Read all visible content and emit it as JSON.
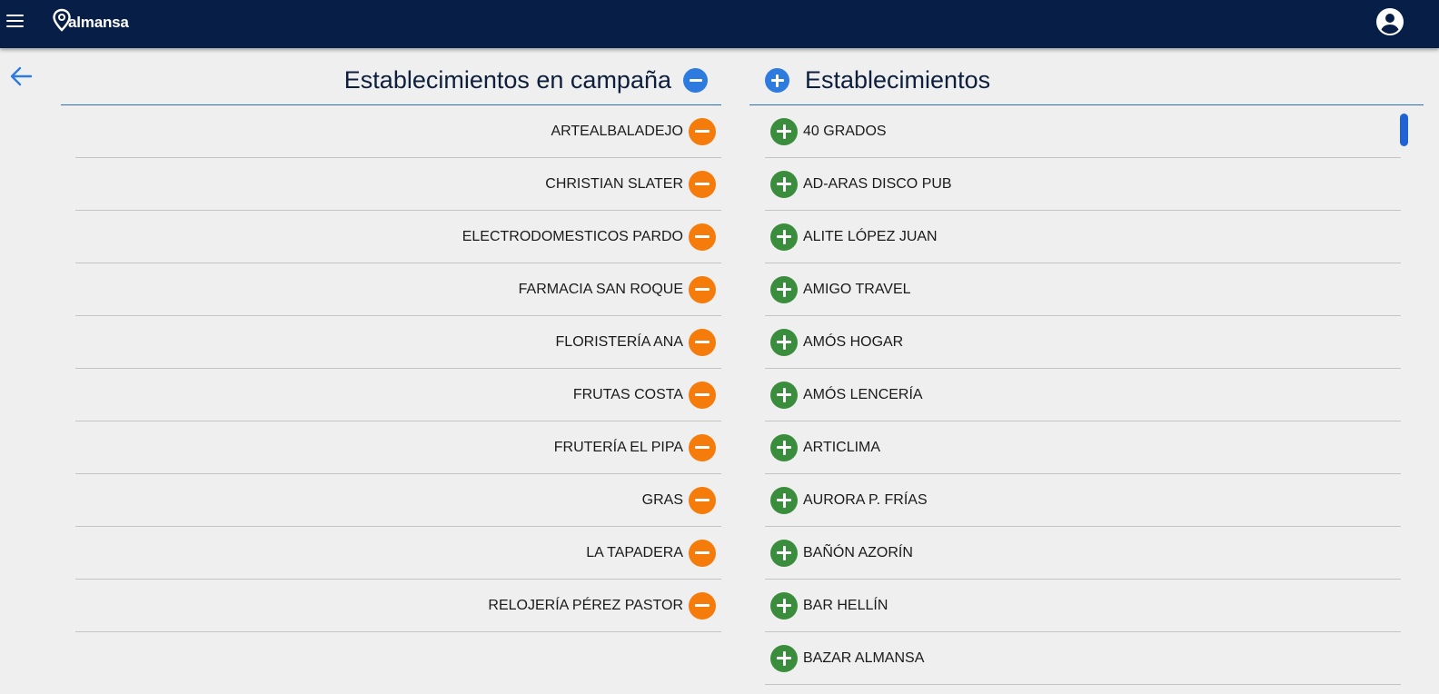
{
  "header": {
    "logo_text": "almansa",
    "colors": {
      "bar": "#071f47"
    }
  },
  "left_panel": {
    "title": "Establecimientos en campaña",
    "items": [
      "ARTEALBALADEJO",
      "CHRISTIAN SLATER",
      "ELECTRODOMESTICOS PARDO",
      "FARMACIA SAN ROQUE",
      "FLORISTERÍA ANA",
      "FRUTAS COSTA",
      "FRUTERÍA EL PIPA",
      "GRAS",
      "LA TAPADERA",
      "RELOJERÍA PÉREZ PASTOR"
    ],
    "item_button_color": "#f57c0a"
  },
  "right_panel": {
    "title": "Establecimientos",
    "items": [
      "40 GRADOS",
      "AD-ARAS DISCO PUB",
      "ALITE LÓPEZ JUAN",
      "AMIGO TRAVEL",
      "AMÓS HOGAR",
      "AMÓS LENCERÍA",
      "ARTICLIMA",
      "AURORA P. FRÍAS",
      "BAÑÓN AZORÍN",
      "BAR HELLÍN",
      "BAZAR ALMANSA"
    ],
    "item_button_color": "#3a8d3c"
  },
  "icons": {
    "menu": "hamburger-menu-icon",
    "account": "account-circle-icon",
    "back": "arrow-left-icon",
    "remove_all": "minus-circle-icon",
    "add_all": "plus-circle-icon",
    "remove": "minus-circle-icon",
    "add": "plus-circle-icon"
  }
}
